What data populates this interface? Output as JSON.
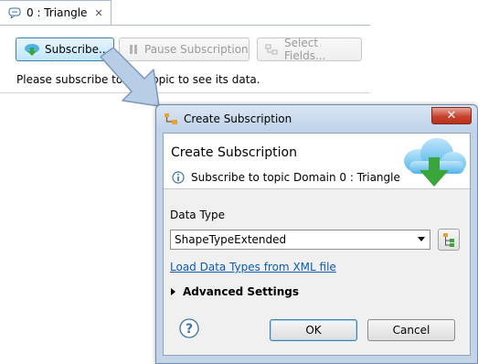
{
  "view": {
    "tab_label": "0 : Triangle",
    "tab_close": "✕",
    "toolbar": {
      "subscribe_label": "Subscribe...",
      "pause_label": "Pause Subscription",
      "select_fields_label": "Select Fields..."
    },
    "message": "Please subscribe to the topic to see its data."
  },
  "dialog": {
    "window_title": "Create Subscription",
    "close_glyph": "✕",
    "header_title": "Create Subscription",
    "header_message": "Subscribe to topic Domain 0 : Triangle",
    "data_type_label": "Data Type",
    "data_type_value": "ShapeTypeExtended",
    "load_xml_link": "Load Data Types from XML file",
    "advanced_label": "Advanced Settings",
    "help_glyph": "?",
    "ok_label": "OK",
    "cancel_label": "Cancel"
  },
  "icons": {
    "tab": "topic-icon",
    "subscribe": "cloud-download-icon",
    "pause": "pause-icon",
    "select_fields": "select-fields-icon",
    "dialog_title": "subscription-icon",
    "info": "info-icon",
    "header_image": "cloud-download-icon",
    "type_browser": "type-tree-icon",
    "help": "help-icon"
  },
  "colors": {
    "accent_blue": "#3c7fb1",
    "cloud_blue": "#4fb3e8",
    "arrow_green": "#3aa53a",
    "link": "#0b5bb3",
    "close_red": "#c7422d",
    "pointer_arrow": "#b8cde6"
  }
}
